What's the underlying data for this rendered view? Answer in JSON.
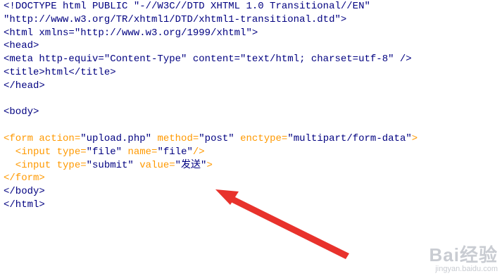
{
  "editor": {
    "colors": {
      "default": "#000080",
      "tag": "#ff9900",
      "value": "#000080"
    },
    "lines": [
      [
        {
          "text": "<!DOCTYPE html PUBLIC \"-//W3C//DTD XHTML 1.0 Transitional//EN\"",
          "role": "default"
        }
      ],
      [
        {
          "text": "\"http://www.w3.org/TR/xhtml1/DTD/xhtml1-transitional.dtd\">",
          "role": "default"
        }
      ],
      [
        {
          "text": "<html xmlns=\"http://www.w3.org/1999/xhtml\">",
          "role": "default"
        }
      ],
      [
        {
          "text": "<head>",
          "role": "default"
        }
      ],
      [
        {
          "text": "<meta http-equiv=\"Content-Type\" content=\"text/html; charset=utf-8\" />",
          "role": "default"
        }
      ],
      [
        {
          "text": "<title>html</title>",
          "role": "default"
        }
      ],
      [
        {
          "text": "</head>",
          "role": "default"
        }
      ],
      [],
      [
        {
          "text": "<body>",
          "role": "default"
        }
      ],
      [],
      [
        {
          "text": "<form action=",
          "role": "tag"
        },
        {
          "text": "\"upload.php\"",
          "role": "value"
        },
        {
          "text": " method=",
          "role": "tag"
        },
        {
          "text": "\"post\"",
          "role": "value"
        },
        {
          "text": " enctype=",
          "role": "tag"
        },
        {
          "text": "\"multipart/form-data\"",
          "role": "value"
        },
        {
          "text": ">",
          "role": "tag"
        }
      ],
      [
        {
          "text": "  <input type=",
          "role": "tag"
        },
        {
          "text": "\"file\"",
          "role": "value"
        },
        {
          "text": " name=",
          "role": "tag"
        },
        {
          "text": "\"file\"",
          "role": "value"
        },
        {
          "text": "/>",
          "role": "tag"
        }
      ],
      [
        {
          "text": "  <input type=",
          "role": "tag"
        },
        {
          "text": "\"submit\"",
          "role": "value"
        },
        {
          "text": " value=",
          "role": "tag"
        },
        {
          "text": "\"发送\"",
          "role": "value"
        },
        {
          "text": ">",
          "role": "tag"
        }
      ],
      [
        {
          "text": "</form>",
          "role": "tag"
        }
      ],
      [
        {
          "text": "</body>",
          "role": "default"
        }
      ],
      [
        {
          "text": "</html>",
          "role": "default"
        }
      ]
    ]
  },
  "annotation": {
    "color": "#e8322c",
    "icon": "red-arrow-icon"
  },
  "watermark": {
    "brand": "Bai经验",
    "url": "jingyan.baidu.com",
    "color": "#c9ccd2"
  }
}
